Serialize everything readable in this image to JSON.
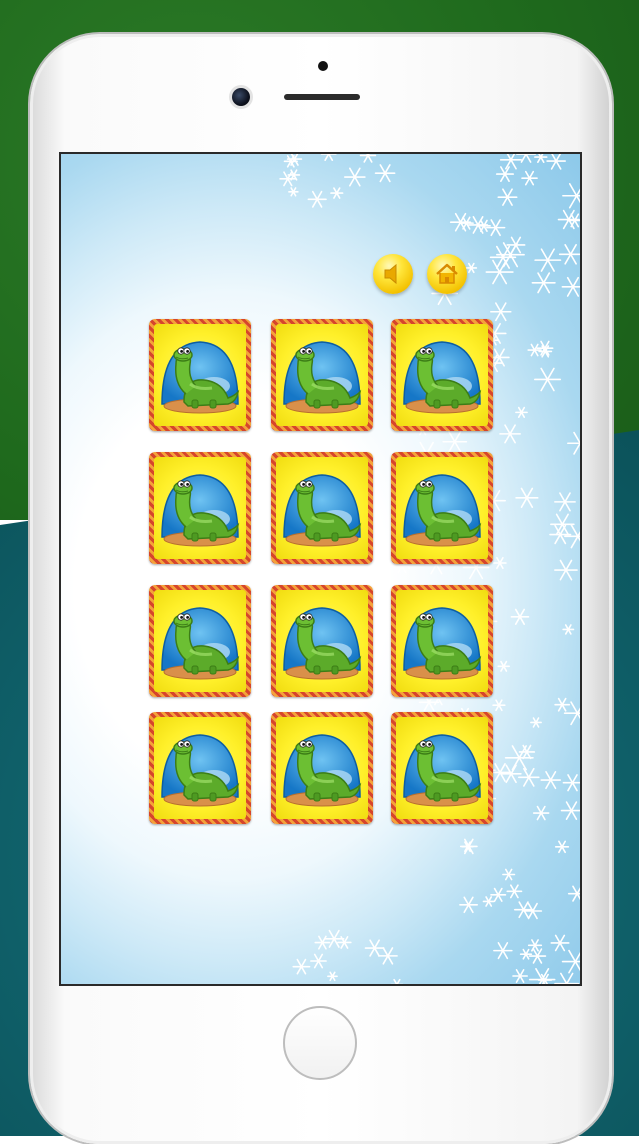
{
  "game": {
    "title": "",
    "controls": {
      "sound_icon": "speaker-icon",
      "home_icon": "home-icon"
    },
    "board": {
      "rows": 4,
      "columns": 3,
      "card_back": "dinosaur",
      "cards": [
        {
          "face": "hidden"
        },
        {
          "face": "hidden"
        },
        {
          "face": "hidden"
        },
        {
          "face": "hidden"
        },
        {
          "face": "hidden"
        },
        {
          "face": "hidden"
        },
        {
          "face": "hidden"
        },
        {
          "face": "hidden"
        },
        {
          "face": "hidden"
        },
        {
          "face": "hidden"
        },
        {
          "face": "hidden"
        },
        {
          "face": "hidden"
        }
      ]
    }
  },
  "colors": {
    "card_border": "#d6452c",
    "card_face": "#fff02a",
    "button_gold": "#ffe53a",
    "sky_blue": "#8dc9ea",
    "dino_green": "#5cab2a"
  }
}
